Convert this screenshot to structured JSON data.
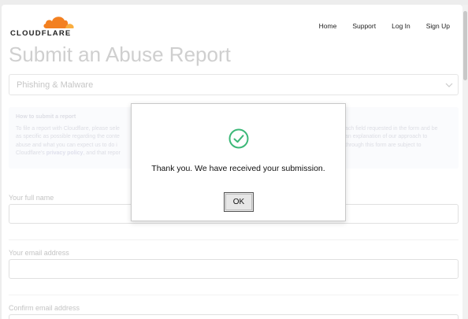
{
  "brand": {
    "logo_text": "CLOUDFLARE",
    "accent": "#f38020",
    "accent_light": "#faae40"
  },
  "nav": {
    "items": [
      "Home",
      "Support",
      "Log In",
      "Sign Up"
    ]
  },
  "page": {
    "title": "Submit an Abuse Report",
    "report_type": "Phishing & Malware",
    "info": {
      "heading": "How to submit a report",
      "line1": "To file a report with Cloudflare, please sele",
      "line1b": "ach field requested in the form and be",
      "line2": "as specific as possible regarding the conte",
      "line2b": "an explanation of our approach to",
      "line3": "abuse and what you can expect us to do i",
      "line3b": "through this form are subject to",
      "line4a": "Cloudflare's",
      "link": "privacy policy",
      "line4b": ", and that repor"
    },
    "fields": {
      "full_name_label": "Your full name",
      "email_label": "Your email address",
      "confirm_email_label": "Confirm email address"
    }
  },
  "modal": {
    "icon": "check-circle-icon",
    "icon_color": "#3cb878",
    "message": "Thank you. We have received your submission.",
    "ok_label": "OK"
  }
}
